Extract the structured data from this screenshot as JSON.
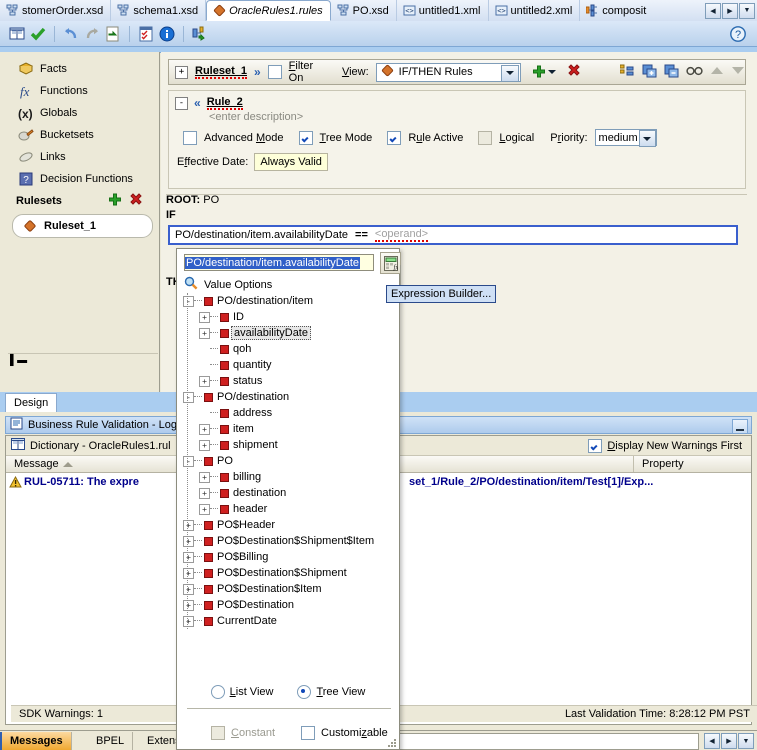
{
  "editor_tabs": [
    {
      "label": "stomerOrder.xsd",
      "icon": "xsd-icon",
      "selected": false
    },
    {
      "label": "schema1.xsd",
      "icon": "xsd-icon",
      "selected": false
    },
    {
      "label": "OracleRules1.rules",
      "icon": "rules-diamond-icon",
      "selected": true
    },
    {
      "label": "PO.xsd",
      "icon": "xsd-icon",
      "selected": false
    },
    {
      "label": "untitled1.xml",
      "icon": "xml-icon",
      "selected": false
    },
    {
      "label": "untitled2.xml",
      "icon": "xml-icon",
      "selected": false
    },
    {
      "label": "composit",
      "icon": "composite-icon",
      "selected": false
    }
  ],
  "tab_nav": {
    "prev": "◀",
    "next": "▶",
    "list": "▼"
  },
  "main_toolbar": {
    "items": [
      {
        "name": "dictionary-icon",
        "tooltip": "Dictionary"
      },
      {
        "name": "validate-check-icon",
        "tooltip": "Validate"
      },
      {
        "name": "undo-icon",
        "tooltip": "Undo"
      },
      {
        "name": "redo-icon",
        "tooltip": "Redo"
      },
      {
        "name": "export-icon",
        "tooltip": "Export"
      },
      {
        "name": "test-icon",
        "tooltip": "Test"
      },
      {
        "name": "info-icon",
        "tooltip": "Information"
      },
      {
        "name": "translations-icon",
        "tooltip": "Translations"
      }
    ],
    "help_label": "?"
  },
  "navigator": {
    "items": [
      {
        "label": "Facts",
        "icon": "facts-icon"
      },
      {
        "label": "Functions",
        "icon": "functions-fx-icon"
      },
      {
        "label": "Globals",
        "icon": "globals-x-icon"
      },
      {
        "label": "Bucketsets",
        "icon": "bucketsets-icon"
      },
      {
        "label": "Links",
        "icon": "links-icon"
      },
      {
        "label": "Decision Functions",
        "icon": "decision-functions-icon"
      }
    ],
    "section_title": "Rulesets",
    "add_label": "+",
    "delete_label": "✖",
    "ruleset": {
      "label": "Ruleset_1",
      "icon": "ruleset-icon"
    }
  },
  "design_tab": {
    "label": "Design"
  },
  "ruleset_bar": {
    "expand": "+",
    "name": "Ruleset_1",
    "chevron": "»",
    "filter_label": "Filter On",
    "filter_checked": false,
    "view_label": "View:",
    "view_value": "IF/THEN Rules",
    "add_label": "+",
    "delete_label": "✖",
    "icons": [
      {
        "name": "toggle-tree-icon"
      },
      {
        "name": "expand-all-icon"
      },
      {
        "name": "collapse-all-icon"
      },
      {
        "name": "show-hide-icon"
      },
      {
        "name": "move-up-icon"
      },
      {
        "name": "move-down-icon"
      }
    ]
  },
  "rule": {
    "collapse": "-",
    "chevron": "«",
    "name": "Rule_2",
    "description": "<enter description>",
    "options": [
      {
        "label": "Advanced Mode",
        "checked": false,
        "enabled": true
      },
      {
        "label": "Tree Mode",
        "checked": true,
        "enabled": true
      },
      {
        "label": "Rule Active",
        "checked": true,
        "enabled": true
      },
      {
        "label": "Logical",
        "checked": false,
        "enabled": false
      }
    ],
    "priority_label": "Priority:",
    "priority_value": "medium",
    "effective_date_label": "Effective Date:",
    "effective_date_value": "Always Valid"
  },
  "condition": {
    "root_label": "ROOT:",
    "root_value": "PO",
    "if_label": "IF",
    "then_label": "THEN",
    "left": "PO/destination/item.availabilityDate",
    "operator": "==",
    "right_placeholder": "<operand>"
  },
  "popup": {
    "input_value": "PO/destination/item.availabilityDate",
    "expression_builder_icon": "expression-builder-icon",
    "value_options_label": "Value Options",
    "value_options_icon": "magnifier-icon",
    "tooltip": "Expression Builder...",
    "tree": [
      {
        "label": "PO/destination/item",
        "depth": 0,
        "toggle": "-",
        "selected": false
      },
      {
        "label": "ID",
        "depth": 1,
        "toggle": "+",
        "selected": false
      },
      {
        "label": "availabilityDate",
        "depth": 1,
        "toggle": "+",
        "selected": true
      },
      {
        "label": "qoh",
        "depth": 1,
        "toggle": "",
        "selected": false
      },
      {
        "label": "quantity",
        "depth": 1,
        "toggle": "",
        "selected": false
      },
      {
        "label": "status",
        "depth": 1,
        "toggle": "+",
        "selected": false
      },
      {
        "label": "PO/destination",
        "depth": 0,
        "toggle": "-",
        "selected": false
      },
      {
        "label": "address",
        "depth": 1,
        "toggle": "",
        "selected": false
      },
      {
        "label": "item",
        "depth": 1,
        "toggle": "+",
        "selected": false
      },
      {
        "label": "shipment",
        "depth": 1,
        "toggle": "+",
        "selected": false
      },
      {
        "label": "PO",
        "depth": 0,
        "toggle": "-",
        "selected": false
      },
      {
        "label": "billing",
        "depth": 1,
        "toggle": "+",
        "selected": false
      },
      {
        "label": "destination",
        "depth": 1,
        "toggle": "+",
        "selected": false
      },
      {
        "label": "header",
        "depth": 1,
        "toggle": "+",
        "selected": false
      },
      {
        "label": "PO$Header",
        "depth": 0,
        "toggle": "+",
        "selected": false
      },
      {
        "label": "PO$Destination$Shipment$Item",
        "depth": 0,
        "toggle": "+",
        "selected": false
      },
      {
        "label": "PO$Billing",
        "depth": 0,
        "toggle": "+",
        "selected": false
      },
      {
        "label": "PO$Destination$Shipment",
        "depth": 0,
        "toggle": "+",
        "selected": false
      },
      {
        "label": "PO$Destination$Item",
        "depth": 0,
        "toggle": "+",
        "selected": false
      },
      {
        "label": "PO$Destination",
        "depth": 0,
        "toggle": "+",
        "selected": false
      },
      {
        "label": "CurrentDate",
        "depth": 0,
        "toggle": "+",
        "selected": false
      }
    ],
    "view_modes": [
      {
        "label": "List View",
        "selected": false
      },
      {
        "label": "Tree View",
        "selected": true
      }
    ],
    "checkboxes": [
      {
        "label": "Constant",
        "checked": false,
        "enabled": false
      },
      {
        "label": "Customizable",
        "checked": false,
        "enabled": true
      }
    ]
  },
  "log": {
    "title": "Business Rule Validation - Log",
    "title_icon": "log-icon",
    "dictionary_label": "Dictionary - OracleRules1.rul",
    "dictionary_icon": "dictionary-book-icon",
    "display_new_warnings_label": "Display New Warnings First",
    "display_new_warnings_checked": true,
    "columns": [
      "Message",
      "Property"
    ],
    "rows": [
      {
        "icon": "warning-icon",
        "message": "RUL-05711: The expre",
        "property": "set_1/Rule_2/PO/destination/item/Test[1]/Exp..."
      }
    ],
    "status_left": "SDK Warnings: 1",
    "status_right": "Last Validation Time: 8:28:12 PM PST"
  },
  "dock_tabs": [
    {
      "label": "Messages",
      "selected": true
    },
    {
      "label": "BPEL",
      "selected": false
    },
    {
      "label": "Extens",
      "selected": false
    }
  ],
  "colors": {
    "accent_blue": "#3a5fcd",
    "warning_yellow": "#f2c230",
    "link_blue": "#00008b",
    "selected_tab_orange": "#f0a830",
    "node_red": "#cf2020"
  }
}
